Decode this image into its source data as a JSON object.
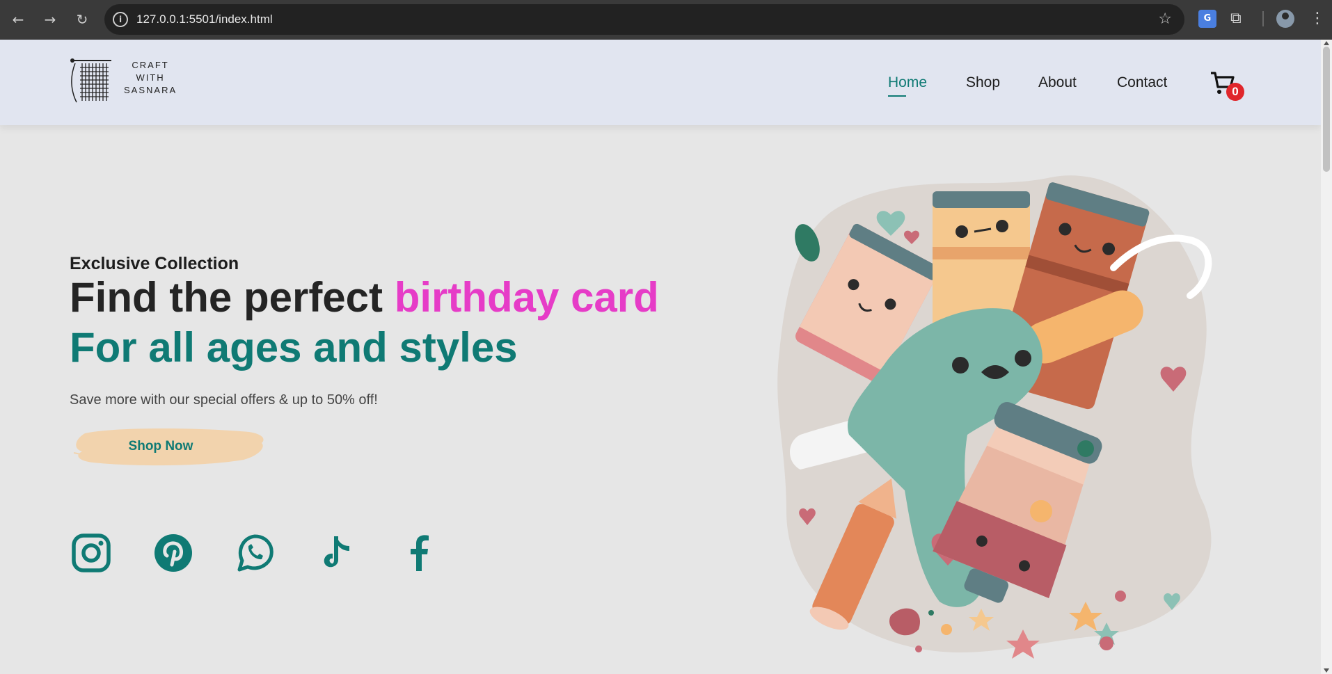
{
  "browser": {
    "url": "127.0.0.1:5501/index.html",
    "translate_label": "G"
  },
  "header": {
    "logo_lines": [
      "CRAFT",
      "WITH",
      "SASNARA"
    ],
    "nav": [
      {
        "label": "Home",
        "active": true
      },
      {
        "label": "Shop",
        "active": false
      },
      {
        "label": "About",
        "active": false
      },
      {
        "label": "Contact",
        "active": false
      }
    ],
    "cart_count": "0"
  },
  "hero": {
    "kicker": "Exclusive Collection",
    "title_prefix": "Find the perfect ",
    "title_highlight": "birthday card",
    "subtitle": "For all ages and styles",
    "description": "Save more with our special offers & up to 50% off!",
    "cta_label": "Shop Now"
  },
  "social": [
    {
      "icon": "instagram-icon"
    },
    {
      "icon": "pinterest-icon"
    },
    {
      "icon": "whatsapp-icon"
    },
    {
      "icon": "tiktok-icon"
    },
    {
      "icon": "facebook-icon"
    }
  ],
  "colors": {
    "accent": "#0f7a74",
    "highlight": "#e63cc7",
    "header_bg": "#e1e5f0",
    "page_bg": "#e6e6e6",
    "badge": "#e0262b",
    "cta_bg": "#f2d3ad"
  }
}
